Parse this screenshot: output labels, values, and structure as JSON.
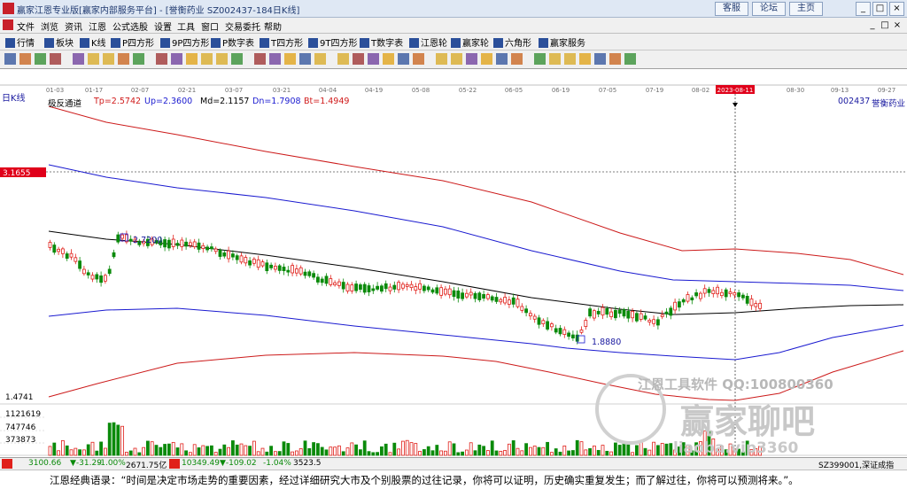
{
  "window": {
    "title": "赢家江恩专业版[赢家内部服务平台] - [誉衡药业  SZ002437-184日K线]",
    "links": [
      "客服",
      "论坛",
      "主页"
    ],
    "controls": [
      "_",
      "□",
      "×"
    ]
  },
  "menu": {
    "items": [
      "文件",
      "浏览",
      "资讯",
      "江恩",
      "公式选股",
      "设置",
      "工具",
      "窗口",
      "交易委托",
      "帮助"
    ],
    "right_controls": [
      "_",
      "□",
      "×"
    ]
  },
  "toolbar": {
    "buttons": [
      "行情",
      "板块",
      "K线",
      "P四方形",
      "9P四方形",
      "P数字表",
      "T四方形",
      "9T四方形",
      "T数字表",
      "江恩轮",
      "赢家轮",
      "六角形",
      "赢家服务"
    ]
  },
  "chart": {
    "period_label": "日K线",
    "date_ticks": [
      "01-03",
      "01-17",
      "02-07",
      "02-21",
      "03-07",
      "03-21",
      "04-04",
      "04-19",
      "05-08",
      "05-22",
      "06-05",
      "06-19",
      "07-05",
      "07-19",
      "08-02",
      "2023-08-11",
      "08-30",
      "09-13",
      "09-27"
    ],
    "indicator": {
      "name": "极反通道",
      "tp": "Tp=2.5742",
      "up": "Up=2.3600",
      "md": "Md=2.1157",
      "dn": "Dn=1.7908",
      "bt": "Bt=1.4949"
    },
    "stock": {
      "code": "002437",
      "name": "誉衡药业"
    },
    "price_cursor": "3.1655",
    "annotations": {
      "high": "2.7200",
      "low": "1.8880"
    },
    "axis_price_low": "1.4741",
    "volume_ticks": [
      "1121619",
      "747746",
      "373873"
    ],
    "watermark": {
      "line1": "江恩工具软件  QQ:100800360",
      "line2": "赢家聊吧",
      "line3": "liaoba.vip3360"
    }
  },
  "status": {
    "sh_index": "3100.66",
    "sh_change": "▼-31.29",
    "sh_pct": "-1.00%",
    "sh_amount": "2671.75亿",
    "sz_index": "10349.49",
    "sz_change": "▼-109.02",
    "sz_pct": "-1.04%",
    "sz_amount": "3523.5",
    "right_text": "SZ399001,深证成指"
  },
  "footer_quote": "江恩经典语录：“时间是决定市场走势的重要因素，经过详细研究大市及个别股票的过往记录，你将可以证明，历史确实重复发生；而了解过往，你将可以预测将来。”。",
  "colors": {
    "up_candle": "#e0201a",
    "down_candle": "#0a8a0a",
    "mid_line": "#000000",
    "band_blue": "#1a1ad0",
    "band_red": "#cc1a1a",
    "cursor_box": "#e0001a"
  }
}
